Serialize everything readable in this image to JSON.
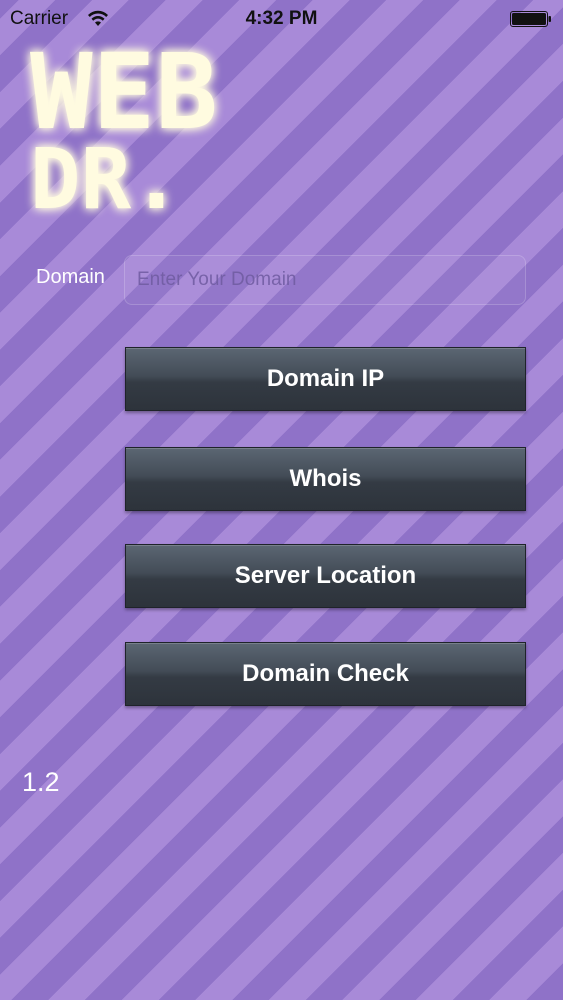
{
  "status_bar": {
    "carrier": "Carrier",
    "time": "4:32 PM",
    "wifi_icon": "wifi-icon",
    "battery_icon": "battery-icon"
  },
  "logo": {
    "line1": "WEB",
    "line2": "DR.",
    "glow_color": "#fff6b0"
  },
  "domain": {
    "label": "Domain",
    "placeholder": "Enter Your Domain",
    "value": ""
  },
  "buttons": [
    {
      "label": "Domain IP"
    },
    {
      "label": "Whois"
    },
    {
      "label": "Server Location"
    },
    {
      "label": "Domain Check"
    }
  ],
  "version": "1.2",
  "colors": {
    "background": "#9b7fd1",
    "stripe_dark": "#8f72c8",
    "stripe_light": "#a88ad8",
    "button": "#3d454f"
  }
}
